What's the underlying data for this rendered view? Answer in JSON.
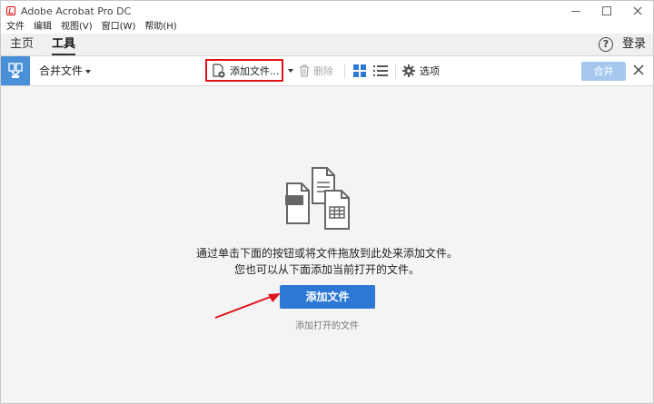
{
  "window": {
    "title": "Adobe Acrobat Pro DC"
  },
  "menu": [
    "文件",
    "编辑",
    "视图(V)",
    "窗口(W)",
    "帮助(H)"
  ],
  "nav": {
    "tabs": [
      "主页",
      "工具"
    ],
    "active": "工具",
    "login": "登录"
  },
  "toolbar": {
    "tool_name": "合并文件",
    "add_files": "添加文件...",
    "delete": "删除",
    "options": "选项",
    "merge": "合并"
  },
  "main": {
    "instruction_line1": "通过单击下面的按钮或将文件拖放到此处来添加文件。",
    "instruction_line2": "您也可以从下面添加当前打开的文件。",
    "add_files_button": "添加文件",
    "add_open_files": "添加打开的文件"
  },
  "colors": {
    "accent": "#2c78d4",
    "highlight": "#e0131a",
    "tool_icon_bg": "#4a90d9",
    "merge_disabled": "#a6c8ef"
  }
}
